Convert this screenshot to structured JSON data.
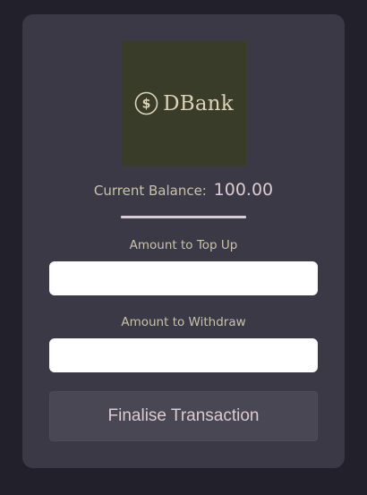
{
  "logo": {
    "icon": "dollar-circle-icon",
    "text": "DBank"
  },
  "balance": {
    "label": "Current Balance:",
    "value": "100.00"
  },
  "top_up": {
    "label": "Amount to Top Up",
    "value": "",
    "placeholder": ""
  },
  "withdraw": {
    "label": "Amount to Withdraw",
    "value": "",
    "placeholder": ""
  },
  "submit": {
    "label": "Finalise Transaction"
  },
  "colors": {
    "background": "#22202b",
    "card": "#3b3945",
    "logo_bg": "#383c28",
    "accent": "#dccbd1",
    "label_text": "#c9c3a8",
    "button_bg": "#4a4754"
  }
}
